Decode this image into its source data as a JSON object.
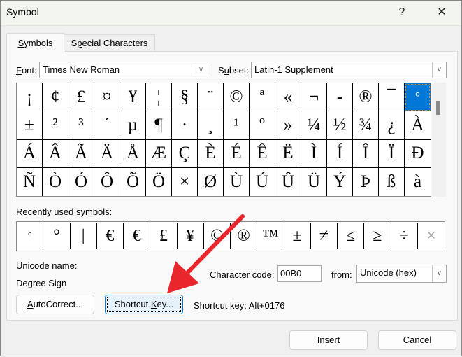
{
  "window": {
    "title": "Symbol",
    "help_label": "?",
    "close_label": "✕"
  },
  "tabs": [
    {
      "label_u": "S",
      "label_rest": "ymbols",
      "active": true
    },
    {
      "label_pre": "S",
      "label_u": "p",
      "label_rest": "ecial Characters",
      "active": false
    }
  ],
  "font": {
    "label_u": "F",
    "label_rest": "ont:",
    "value": "Times New Roman"
  },
  "subset": {
    "label_pre": "S",
    "label_u": "u",
    "label_rest": "bset:",
    "value": "Latin-1 Supplement"
  },
  "symbol_grid": {
    "selected_index": 15,
    "symbols": [
      "¡",
      "¢",
      "£",
      "¤",
      "¥",
      "¦",
      "§",
      "¨",
      "©",
      "ª",
      "«",
      "¬",
      "-",
      "®",
      "¯",
      "°",
      "±",
      "²",
      "³",
      "´",
      "µ",
      "¶",
      "·",
      "¸",
      "¹",
      "º",
      "»",
      "¼",
      "½",
      "¾",
      "¿",
      "À",
      "Á",
      "Â",
      "Ã",
      "Ä",
      "Å",
      "Æ",
      "Ç",
      "È",
      "É",
      "Ê",
      "Ë",
      "Ì",
      "Í",
      "Î",
      "Ï",
      "Ð",
      "Ñ",
      "Ò",
      "Ó",
      "Ô",
      "Õ",
      "Ö",
      "×",
      "Ø",
      "Ù",
      "Ú",
      "Û",
      "Ü",
      "Ý",
      "Þ",
      "ß",
      "à"
    ]
  },
  "recent": {
    "label_u": "R",
    "label_rest": "ecently used symbols:",
    "symbols": [
      "°",
      "°",
      "|",
      "€",
      "€",
      "£",
      "¥",
      "©",
      "®",
      "™",
      "±",
      "≠",
      "≤",
      "≥",
      "÷",
      "×"
    ]
  },
  "unicode_name": {
    "label": "Unicode name:",
    "value": "Degree Sign"
  },
  "char_code": {
    "label_u": "C",
    "label_rest": "haracter code:",
    "value": "00B0"
  },
  "from": {
    "label_pre": "fro",
    "label_u": "m",
    "label_rest": ":",
    "value": "Unicode (hex)"
  },
  "buttons": {
    "autocorrect_u": "A",
    "autocorrect_rest": "utoCorrect...",
    "shortcut_pre": "Shortcut ",
    "shortcut_u": "K",
    "shortcut_rest": "ey...",
    "insert_u": "I",
    "insert_rest": "nsert",
    "cancel": "Cancel"
  },
  "shortcut_key_text": "Shortcut key: Alt+0176",
  "colors": {
    "selection": "#0078d7",
    "annotation_arrow": "#e8262b",
    "focus_border": "#0078d7"
  }
}
